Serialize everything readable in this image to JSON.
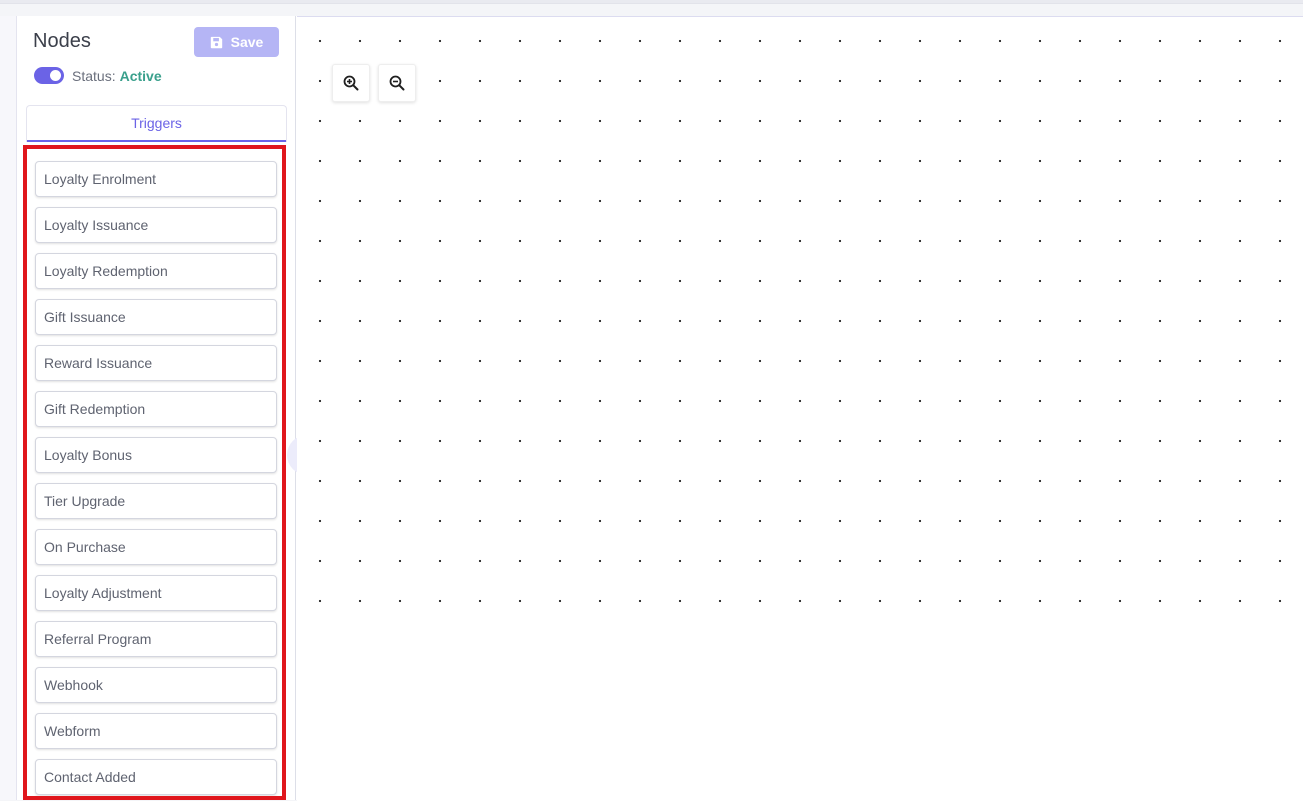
{
  "sidebar": {
    "title": "Nodes",
    "save_label": "Save",
    "status_label": "Status:",
    "status_value": "Active",
    "tabs": [
      {
        "label": "Triggers"
      }
    ],
    "triggers": [
      {
        "label": "Loyalty Enrolment"
      },
      {
        "label": "Loyalty Issuance"
      },
      {
        "label": "Loyalty Redemption"
      },
      {
        "label": "Gift Issuance"
      },
      {
        "label": "Reward Issuance"
      },
      {
        "label": "Gift Redemption"
      },
      {
        "label": "Loyalty Bonus"
      },
      {
        "label": "Tier Upgrade"
      },
      {
        "label": "On Purchase"
      },
      {
        "label": "Loyalty Adjustment"
      },
      {
        "label": "Referral Program"
      },
      {
        "label": "Webhook"
      },
      {
        "label": "Webform"
      },
      {
        "label": "Contact Added"
      }
    ]
  },
  "canvas": {
    "zoom_in_icon": "zoom-in-icon",
    "zoom_out_icon": "zoom-out-icon"
  },
  "colors": {
    "accent": "#6b63e6",
    "save_button": "#b5b5f5",
    "status_active": "#3aa08c",
    "highlight_border": "#e0161c"
  }
}
